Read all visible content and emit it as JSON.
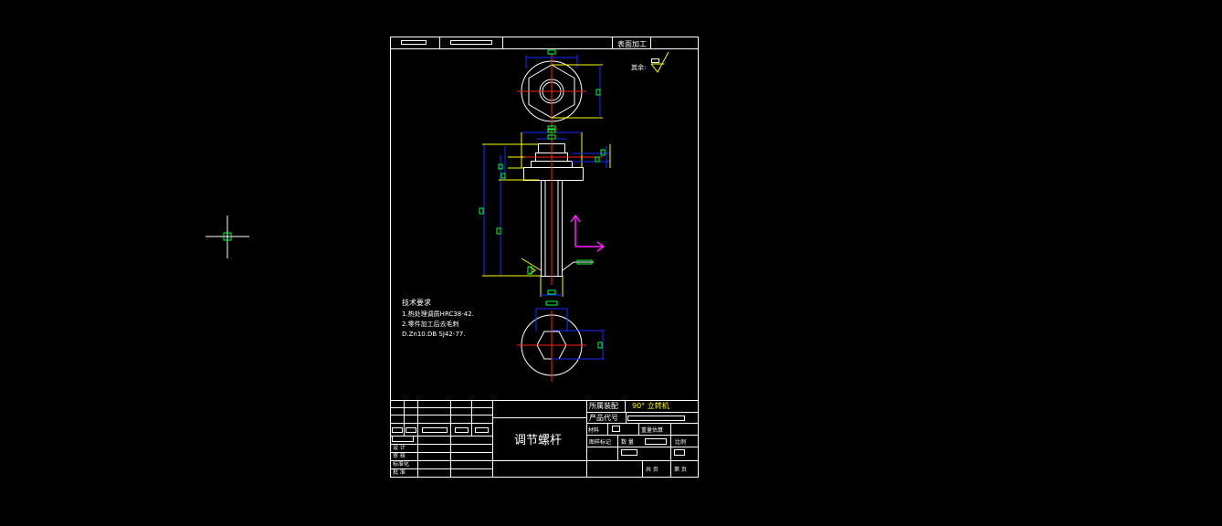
{
  "drawing": {
    "surface_treatment": "表面加工",
    "rest_note": "其余:",
    "tech_requirements": {
      "title": "技术要求",
      "items": [
        "1.热处理调质HRC38-42.",
        "2.零件加工后去毛刺",
        "D.Zn10.DB SJ42-77."
      ]
    },
    "title_block": {
      "part_name": "调节螺杆",
      "assembly_label": "所属装配",
      "assembly_value": "90° 立转机",
      "product_code_label": "产品代号",
      "material_label": "材料",
      "quantity_label": "数量",
      "scale_label": "比例",
      "mark_label": "图样标记",
      "count_label": "数 量",
      "weight_label": "重量估算",
      "sheet_total": "共 页",
      "sheet_no": "第 页",
      "roles": [
        "设 计",
        "审 核",
        "标准化",
        "批 准"
      ]
    }
  },
  "colors": {
    "outline": "#ffffff",
    "centerline": "#ff2020",
    "dimension": "#1a2cff",
    "extension": "#ffff00",
    "dim_box": "#00ff3a",
    "ucs": "#ff20ff",
    "cursor": "#ffffff",
    "cursor_box": "#00ff3a"
  },
  "icons": {
    "cursor": "crosshair-icon",
    "ucs": "ucs-axis-icon",
    "roughness": "surface-roughness-icon"
  }
}
